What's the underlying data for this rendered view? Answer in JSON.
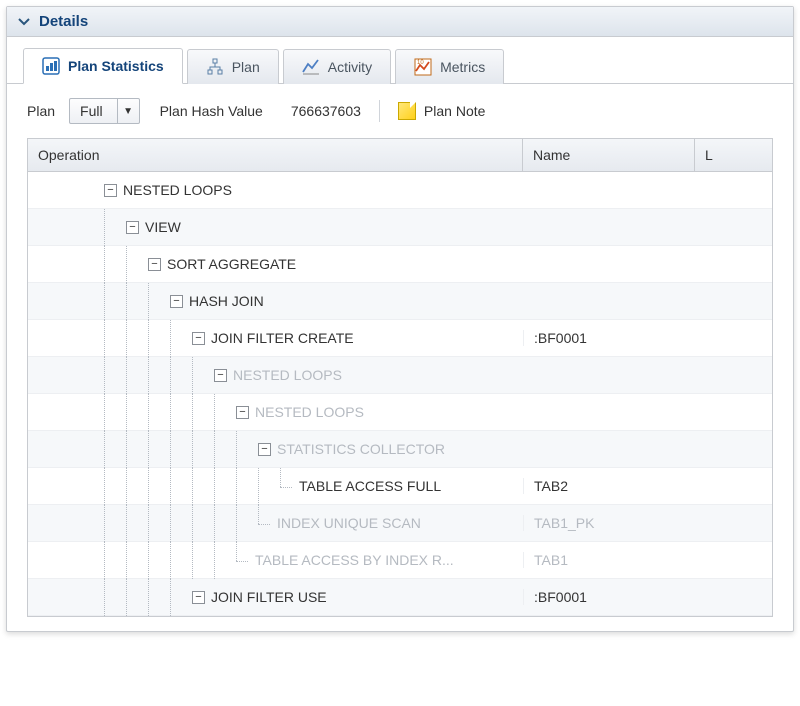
{
  "panel": {
    "title": "Details"
  },
  "tabs": [
    {
      "label": "Plan Statistics"
    },
    {
      "label": "Plan"
    },
    {
      "label": "Activity"
    },
    {
      "label": "Metrics"
    }
  ],
  "toolbar": {
    "plan_label": "Plan",
    "plan_select_value": "Full",
    "hash_label": "Plan Hash Value",
    "hash_value": "766637603",
    "note_label": "Plan Note"
  },
  "columns": {
    "operation": "Operation",
    "name": "Name",
    "third": "L"
  },
  "rows": [
    {
      "indent": 3,
      "toggle": true,
      "dim": false,
      "op": "NESTED LOOPS",
      "name": ""
    },
    {
      "indent": 4,
      "toggle": true,
      "dim": false,
      "op": "VIEW",
      "name": ""
    },
    {
      "indent": 5,
      "toggle": true,
      "dim": false,
      "op": "SORT AGGREGATE",
      "name": ""
    },
    {
      "indent": 6,
      "toggle": true,
      "dim": false,
      "op": "HASH JOIN",
      "name": ""
    },
    {
      "indent": 7,
      "toggle": true,
      "dim": false,
      "op": "JOIN FILTER CREATE",
      "name": ":BF0001"
    },
    {
      "indent": 8,
      "toggle": true,
      "dim": true,
      "op": "NESTED LOOPS",
      "name": ""
    },
    {
      "indent": 9,
      "toggle": true,
      "dim": true,
      "op": "NESTED LOOPS",
      "name": ""
    },
    {
      "indent": 10,
      "toggle": true,
      "dim": true,
      "op": "STATISTICS COLLECTOR",
      "name": ""
    },
    {
      "indent": 11,
      "toggle": false,
      "dim": false,
      "op": "TABLE ACCESS FULL",
      "name": "TAB2"
    },
    {
      "indent": 10,
      "toggle": false,
      "dim": true,
      "op": "INDEX UNIQUE SCAN",
      "name": "TAB1_PK"
    },
    {
      "indent": 9,
      "toggle": false,
      "dim": true,
      "op": "TABLE ACCESS BY INDEX R...",
      "name": "TAB1"
    },
    {
      "indent": 7,
      "toggle": true,
      "dim": false,
      "op": "JOIN FILTER USE",
      "name": ":BF0001"
    }
  ]
}
